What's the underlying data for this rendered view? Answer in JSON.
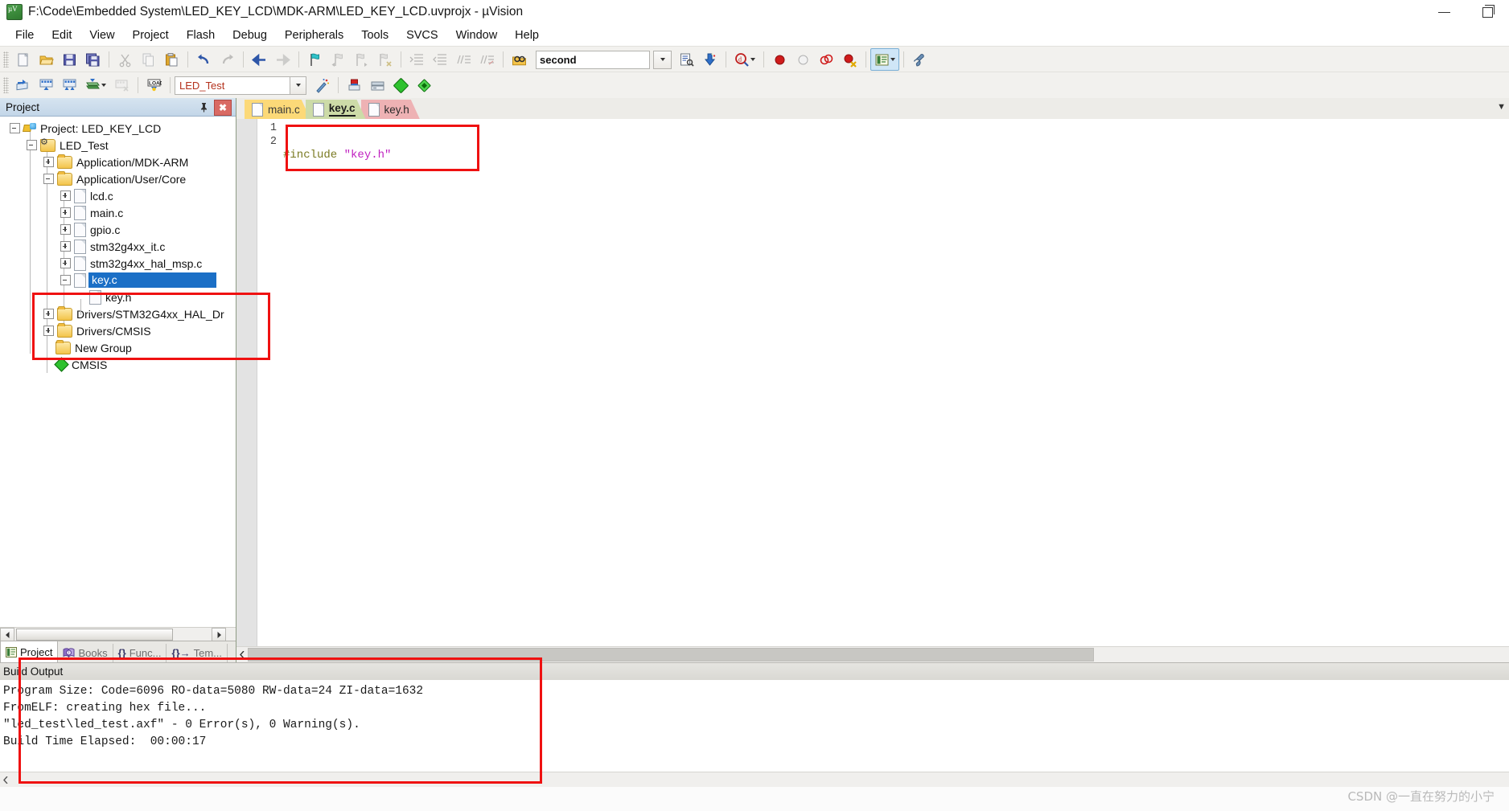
{
  "window": {
    "title": "F:\\Code\\Embedded System\\LED_KEY_LCD\\MDK-ARM\\LED_KEY_LCD.uvprojx - µVision",
    "app_icon": "uvision-logo-icon",
    "minimize": "—",
    "restore": "❐"
  },
  "menu": [
    {
      "label": "File"
    },
    {
      "label": "Edit"
    },
    {
      "label": "View"
    },
    {
      "label": "Project"
    },
    {
      "label": "Flash"
    },
    {
      "label": "Debug"
    },
    {
      "label": "Peripherals"
    },
    {
      "label": "Tools"
    },
    {
      "label": "SVCS"
    },
    {
      "label": "Window"
    },
    {
      "label": "Help"
    }
  ],
  "toolbar_main": {
    "search_value": "second",
    "buttons": [
      {
        "name": "new-file-button",
        "icon": "new-file-icon"
      },
      {
        "name": "open-file-button",
        "icon": "open-folder-icon"
      },
      {
        "name": "save-button",
        "icon": "save-disk-icon"
      },
      {
        "name": "save-all-button",
        "icon": "save-all-icon"
      },
      {
        "name": "cut-button",
        "icon": "scissors-icon"
      },
      {
        "name": "copy-button",
        "icon": "copy-icon"
      },
      {
        "name": "paste-button",
        "icon": "paste-icon"
      },
      {
        "name": "undo-button",
        "icon": "undo-arrow-icon"
      },
      {
        "name": "redo-button",
        "icon": "redo-arrow-icon"
      },
      {
        "name": "navigate-back-button",
        "icon": "arrow-left-icon"
      },
      {
        "name": "navigate-forward-button",
        "icon": "arrow-right-icon"
      },
      {
        "name": "toggle-bookmark-button",
        "icon": "bookmark-flag-icon"
      },
      {
        "name": "prev-bookmark-button",
        "icon": "bookmark-prev-icon"
      },
      {
        "name": "next-bookmark-button",
        "icon": "bookmark-next-icon"
      },
      {
        "name": "clear-bookmarks-button",
        "icon": "bookmark-clear-icon"
      },
      {
        "name": "indent-button",
        "icon": "indent-right-icon"
      },
      {
        "name": "outdent-button",
        "icon": "indent-left-icon"
      },
      {
        "name": "comment-button",
        "icon": "comment-lines-icon"
      },
      {
        "name": "uncomment-button",
        "icon": "uncomment-lines-icon"
      },
      {
        "name": "find-in-files-button",
        "icon": "binoculars-folder-icon"
      },
      {
        "name": "search-dropdown-button",
        "icon": "chevron-down-icon"
      },
      {
        "name": "bookmark-list-button",
        "icon": "document-search-icon"
      },
      {
        "name": "go-to-definition-button",
        "icon": "blue-down-arrow-icon"
      },
      {
        "name": "debug-search-button",
        "icon": "magnifier-d-icon"
      },
      {
        "name": "breakpoint-insert-button",
        "icon": "red-dot-icon"
      },
      {
        "name": "breakpoint-disable-button",
        "icon": "hollow-dot-icon"
      },
      {
        "name": "breakpoint-disable-all-button",
        "icon": "two-rings-icon"
      },
      {
        "name": "breakpoint-kill-all-button",
        "icon": "red-dot-x-icon"
      },
      {
        "name": "window-layout-button",
        "icon": "panels-icon"
      },
      {
        "name": "layout-dropdown-button",
        "icon": "chevron-down-icon"
      },
      {
        "name": "configure-button",
        "icon": "wrench-icon"
      }
    ]
  },
  "toolbar_build": {
    "target_value": "LED_Test",
    "buttons": [
      {
        "name": "translate-button",
        "icon": "translate-icon"
      },
      {
        "name": "build-button",
        "icon": "build-icon"
      },
      {
        "name": "rebuild-button",
        "icon": "rebuild-icon"
      },
      {
        "name": "batch-build-button",
        "icon": "batch-build-icon"
      },
      {
        "name": "batch-dropdown-button",
        "icon": "chevron-down-icon"
      },
      {
        "name": "stop-build-button",
        "icon": "stop-build-icon"
      },
      {
        "name": "download-button",
        "icon": "load-flash-icon"
      },
      {
        "name": "target-dropdown-button",
        "icon": "chevron-down-icon"
      },
      {
        "name": "target-options-button",
        "icon": "magic-wand-icon"
      },
      {
        "name": "manage-project-items-button",
        "icon": "project-items-icon"
      },
      {
        "name": "manage-multi-project-button",
        "icon": "multi-project-icon"
      },
      {
        "name": "pack-installer-button",
        "icon": "green-diamond-icon"
      },
      {
        "name": "manage-run-time-env-button",
        "icon": "rte-diamond-icon"
      },
      {
        "name": "select-software-packs-button",
        "icon": "packs-icon"
      }
    ]
  },
  "project_panel": {
    "title": "Project",
    "pin_icon": "pin-icon",
    "close_icon": "close-icon",
    "tree": [
      {
        "label": "Project: LED_KEY_LCD",
        "indent": 0,
        "toggle": "minus",
        "icon": "project-icon",
        "selected": false
      },
      {
        "label": "LED_Test",
        "indent": 1,
        "toggle": "minus",
        "icon": "target-icon",
        "selected": false
      },
      {
        "label": "Application/MDK-ARM",
        "indent": 2,
        "toggle": "plus",
        "icon": "folder-icon",
        "selected": false
      },
      {
        "label": "Application/User/Core",
        "indent": 2,
        "toggle": "minus",
        "icon": "folder-icon",
        "selected": false
      },
      {
        "label": "lcd.c",
        "indent": 3,
        "toggle": "plus",
        "icon": "c-file-icon",
        "selected": false
      },
      {
        "label": "main.c",
        "indent": 3,
        "toggle": "plus",
        "icon": "c-file-icon",
        "selected": false
      },
      {
        "label": "gpio.c",
        "indent": 3,
        "toggle": "plus",
        "icon": "c-file-icon",
        "selected": false
      },
      {
        "label": "stm32g4xx_it.c",
        "indent": 3,
        "toggle": "plus",
        "icon": "c-file-icon",
        "selected": false
      },
      {
        "label": "stm32g4xx_hal_msp.c",
        "indent": 3,
        "toggle": "plus",
        "icon": "c-file-icon",
        "selected": false
      },
      {
        "label": "key.c",
        "indent": 3,
        "toggle": "minus",
        "icon": "c-file-icon",
        "selected": true
      },
      {
        "label": "key.h",
        "indent": 4,
        "toggle": "none",
        "icon": "h-file-icon",
        "selected": false
      },
      {
        "label": "Drivers/STM32G4xx_HAL_Dr",
        "indent": 2,
        "toggle": "plus",
        "icon": "folder-icon",
        "selected": false
      },
      {
        "label": "Drivers/CMSIS",
        "indent": 2,
        "toggle": "plus",
        "icon": "folder-icon",
        "selected": false
      },
      {
        "label": "New Group",
        "indent": 2,
        "toggle": "none",
        "icon": "folder-icon",
        "selected": false
      },
      {
        "label": "CMSIS",
        "indent": 2,
        "toggle": "none",
        "icon": "cmsis-icon",
        "selected": false
      }
    ],
    "tabs": [
      {
        "label": "Project",
        "icon": "project-tab-icon",
        "active": true
      },
      {
        "label": "Books",
        "icon": "books-icon",
        "active": false
      },
      {
        "label": "Func...",
        "icon": "functions-icon",
        "active": false
      },
      {
        "label": "Tem...",
        "icon": "templates-icon",
        "active": false
      }
    ]
  },
  "editor": {
    "tabs": [
      {
        "label": "main.c",
        "active": false,
        "color": "#fcd978"
      },
      {
        "label": "key.c",
        "active": true,
        "color": "#cddba8"
      },
      {
        "label": "key.h",
        "active": false,
        "color": "#eeb2b4"
      }
    ],
    "line_numbers": [
      "1",
      "2"
    ],
    "code_lines": [
      {
        "tokens": [
          {
            "text": "#include ",
            "type": "preprocessor"
          },
          {
            "text": "\"key.h\"",
            "type": "string"
          }
        ]
      },
      {
        "tokens": [
          {
            "text": "",
            "type": "plain"
          }
        ]
      }
    ],
    "tab_scroll_icon": "chevron-down-icon"
  },
  "build_output": {
    "title": "Build Output",
    "lines": [
      "Program Size: Code=6096 RO-data=5080 RW-data=24 ZI-data=1632",
      "FromELF: creating hex file...",
      "\"led_test\\led_test.axf\" - 0 Error(s), 0 Warning(s).",
      "Build Time Elapsed:  00:00:17"
    ]
  },
  "watermark": {
    "text": "CSDN @一直在努力的小宁"
  },
  "annotations": {
    "color": "#ef1111"
  },
  "colors": {
    "accent_blue": "#1b6fc6",
    "panel_header": "#c3d6e8",
    "tab_active": "#cddba8",
    "annotation_red": "#ef1111",
    "target_text": "#b4311c"
  }
}
